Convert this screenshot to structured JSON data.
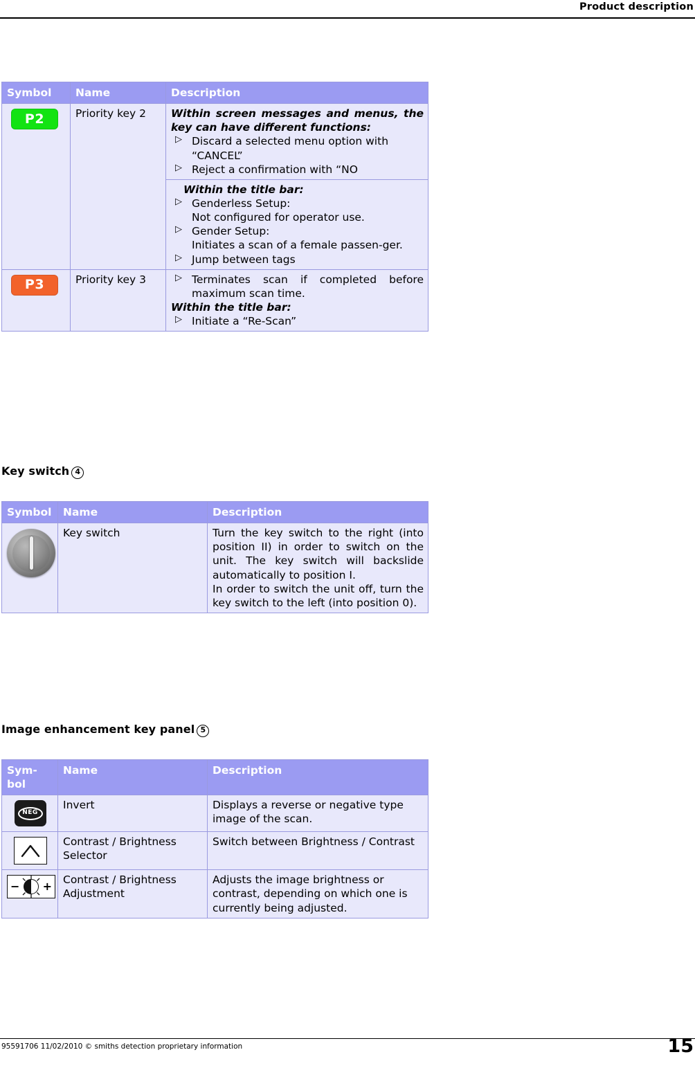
{
  "header": {
    "title": "Product description"
  },
  "footer": {
    "left": "95591706 11/02/2010 © smiths detection proprietary information",
    "page": "15"
  },
  "tables": {
    "priority_keys": {
      "columns": [
        "Symbol",
        "Name",
        "Description"
      ],
      "rows": [
        {
          "symbol_label": "P2",
          "symbol_color": "#13e313",
          "name": "Priority key 2",
          "desc_block_1": {
            "heading": "Within screen messages and menus, the key can have different functions:",
            "bullets": [
              "Discard a selected menu option with “CANCEL”",
              "Reject a confirmation with “NO"
            ]
          },
          "desc_block_2": {
            "heading": "Within the title bar:",
            "bullets": [
              "Genderless Setup:",
              "Gender Setup:",
              "Jump between tags"
            ],
            "sub_lines": [
              "Not configured for operator use.",
              "Initiates a scan of a female passen-ger."
            ]
          }
        },
        {
          "symbol_label": "P3",
          "symbol_color": "#f2622b",
          "name": "Priority key 3",
          "bullet_1": "Terminates scan if completed before maximum scan time.",
          "heading": "Within the title bar:",
          "bullet_2": "Initiate a “Re-Scan”"
        }
      ]
    },
    "key_switch": {
      "heading": "Key switch",
      "heading_num": "4",
      "columns": [
        "Symbol",
        "Name",
        "Description"
      ],
      "row": {
        "symbol_icon": "key-switch-icon",
        "name": "Key switch",
        "description_1": "Turn the key switch to the right (into position II) in order to switch on the unit. The key switch will backslide automatically to position I.",
        "description_2": "In order to switch the unit off, turn the key switch to the left (into position 0)."
      }
    },
    "image_enhancement": {
      "heading": "Image enhancement key panel",
      "heading_num": "5",
      "columns": [
        "Sym-bol",
        "Name",
        "Description"
      ],
      "rows": [
        {
          "symbol_icon": "invert-icon",
          "symbol_text": "NEG",
          "name": "Invert",
          "description": "Displays a reverse or negative type image of the scan."
        },
        {
          "symbol_icon": "contrast-brightness-selector-icon",
          "name": "Contrast / Brightness Selector",
          "description": "Switch between Brightness / Contrast"
        },
        {
          "symbol_icon": "contrast-brightness-adjustment-icon",
          "name": "Contrast / Brightness Adjustment",
          "description": "Adjusts the image brightness or contrast, depending on which one is currently being adjusted."
        }
      ]
    }
  }
}
